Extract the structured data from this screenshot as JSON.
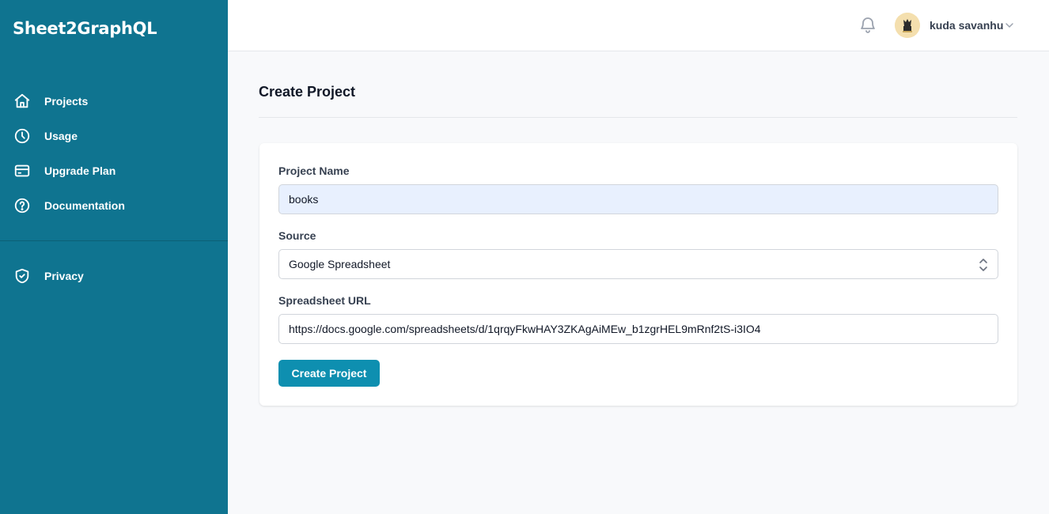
{
  "app": {
    "brand": "Sheet2GraphQL"
  },
  "sidebar": {
    "items": [
      {
        "label": "Projects",
        "icon": "home-icon"
      },
      {
        "label": "Usage",
        "icon": "clock-icon"
      },
      {
        "label": "Upgrade Plan",
        "icon": "credit-card-icon"
      },
      {
        "label": "Documentation",
        "icon": "help-circle-icon"
      }
    ],
    "secondary_items": [
      {
        "label": "Privacy",
        "icon": "shield-check-icon"
      }
    ]
  },
  "topbar": {
    "notifications_icon": "bell-icon",
    "user_name": "kuda savanhu",
    "avatar_icon": "avatar-icon",
    "menu_icon": "chevron-down-icon"
  },
  "page": {
    "title": "Create Project"
  },
  "form": {
    "project_name": {
      "label": "Project Name",
      "value": "books"
    },
    "source": {
      "label": "Source",
      "selected": "Google Spreadsheet"
    },
    "spreadsheet_url": {
      "label": "Spreadsheet URL",
      "value": "https://docs.google.com/spreadsheets/d/1qrqyFkwHAY3ZKAgAiMEw_b1zgrHEL9mRnf2tS-i3IO4"
    },
    "submit_label": "Create Project"
  },
  "colors": {
    "sidebar_bg": "#0f7490",
    "button_bg": "#0e8fb0",
    "page_bg": "#f8f9fb",
    "autofill_bg": "#e8f0fe"
  }
}
